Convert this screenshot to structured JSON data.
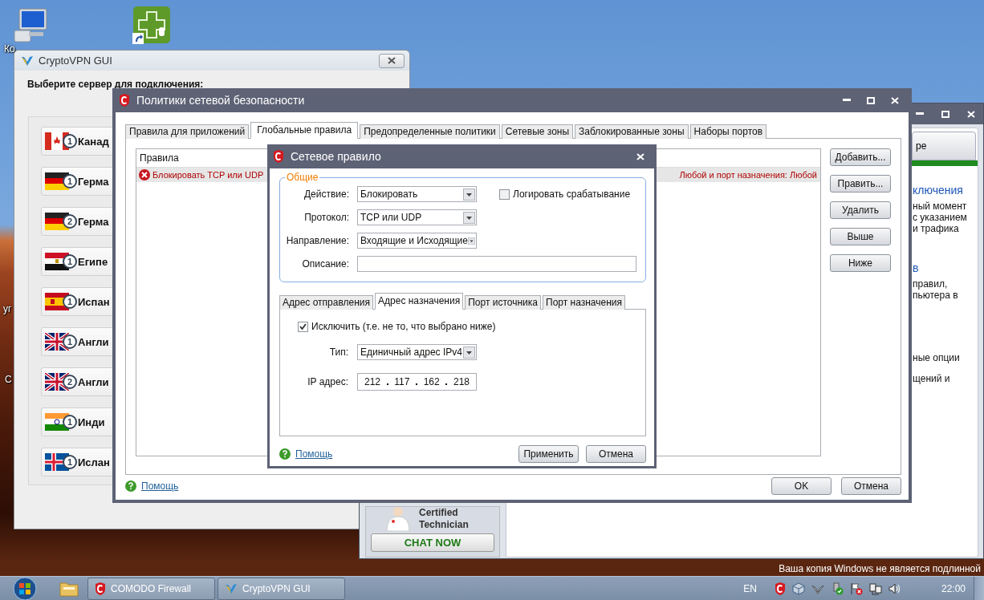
{
  "desktop": {
    "icons": [
      {
        "kind": "computer",
        "label": "Ко"
      },
      {
        "kind": "shortcut"
      }
    ],
    "edge_labels": [
      "уг",
      "С"
    ]
  },
  "crypto_vpn": {
    "title": "CryptoVPN GUI",
    "heading": "Выберите сервер для подключения:",
    "servers": [
      {
        "kind": "ca",
        "number": "1",
        "name": "Канад"
      },
      {
        "kind": "de",
        "number": "1",
        "name": "Герма"
      },
      {
        "kind": "de",
        "number": "2",
        "name": "Герма"
      },
      {
        "kind": "eg",
        "number": "1",
        "name": "Египе"
      },
      {
        "kind": "es",
        "number": "1",
        "name": "Испан"
      },
      {
        "kind": "gb",
        "number": "1",
        "name": "Англи"
      },
      {
        "kind": "gb",
        "number": "2",
        "name": "Англи"
      },
      {
        "kind": "in",
        "number": "1",
        "name": "Инди"
      },
      {
        "kind": "is",
        "number": "1",
        "name": "Ислан"
      }
    ]
  },
  "comodo_main": {
    "tab_label": "ре",
    "sections": [
      {
        "heading": "ключения",
        "lines": [
          "ный момент",
          "с указанием",
          "и трафика"
        ]
      },
      {
        "heading": "в",
        "lines": [
          "правил,",
          "пьютера в"
        ]
      },
      {
        "lines": [
          "ные опции",
          "щений и"
        ]
      }
    ],
    "promo": {
      "lines": [
        "Certified",
        "Technician"
      ],
      "button": "CHAT NOW"
    }
  },
  "policies": {
    "title": "Политики сетевой безопасности",
    "tabs": [
      {
        "label": "Правила для приложений",
        "selected": false
      },
      {
        "label": "Глобальные правила",
        "selected": true
      },
      {
        "label": "Предопределенные политики",
        "selected": false
      },
      {
        "label": "Сетевые зоны",
        "selected": false
      },
      {
        "label": "Заблокированные зоны",
        "selected": false
      },
      {
        "label": "Наборы портов",
        "selected": false
      }
    ],
    "list_header": "Правила",
    "rules": [
      {
        "kind": "block",
        "selected": true,
        "text_start": "Блокировать TCP или UDP",
        "text_end": "Любой и порт назначения: Любой"
      }
    ],
    "side_buttons": [
      "Добавить...",
      "Править...",
      "Удалить",
      "Выше",
      "Ниже"
    ],
    "help": "Помощь",
    "ok": "OK",
    "cancel": "Отмена"
  },
  "rule_dialog": {
    "title": "Сетевое правило",
    "group": "Общие",
    "fields": [
      {
        "kind": "select",
        "label": "Действие:",
        "value": "Блокировать"
      },
      {
        "kind": "select",
        "label": "Протокол:",
        "value": "TCP или UDP"
      },
      {
        "kind": "select",
        "label": "Направление:",
        "value": "Входящие и Исходящие"
      },
      {
        "kind": "text",
        "label": "Описание:"
      }
    ],
    "log": {
      "label": "Логировать срабатывание",
      "checked": false
    },
    "tabs": [
      {
        "label": "Адрес отправления",
        "selected": false
      },
      {
        "label": "Адрес назначения",
        "selected": true
      },
      {
        "label": "Порт источника",
        "selected": false
      },
      {
        "label": "Порт назначения",
        "selected": false
      }
    ],
    "exclude": {
      "label": "Исключить (т.е. не то, что выбрано ниже)",
      "checked": true
    },
    "type_label": "Тип:",
    "type_value": "Единичный адрес IPv4",
    "ip_label": "IP адрес:",
    "ip": [
      "212",
      "117",
      "162",
      "218"
    ],
    "help": "Помощь",
    "apply": "Применить",
    "cancel": "Отмена"
  },
  "taskbar": {
    "buttons": [
      {
        "kind": "comodo",
        "label": "COMODO Firewall"
      },
      {
        "kind": "vpn",
        "label": "CryptoVPN GUI"
      }
    ],
    "notice": "Ваша копия Windows не является подлинной",
    "language": "EN",
    "clock": "22:00"
  }
}
